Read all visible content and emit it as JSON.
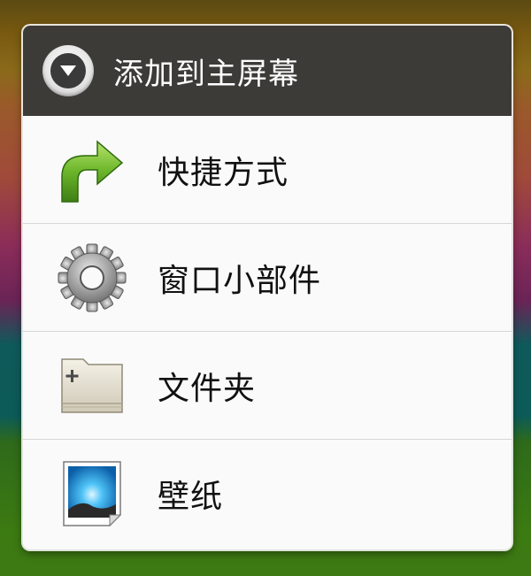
{
  "dialog": {
    "title": "添加到主屏幕",
    "header_icon": "chevron-down-circle-icon",
    "items": [
      {
        "label": "快捷方式",
        "icon": "shortcut-arrow-icon"
      },
      {
        "label": "窗口小部件",
        "icon": "gear-icon"
      },
      {
        "label": "文件夹",
        "icon": "folder-icon"
      },
      {
        "label": "壁纸",
        "icon": "wallpaper-icon"
      }
    ]
  },
  "colors": {
    "header_bg": "#3c3b37",
    "list_bg": "#fafafa",
    "arrow_green": "#6bb52a"
  }
}
